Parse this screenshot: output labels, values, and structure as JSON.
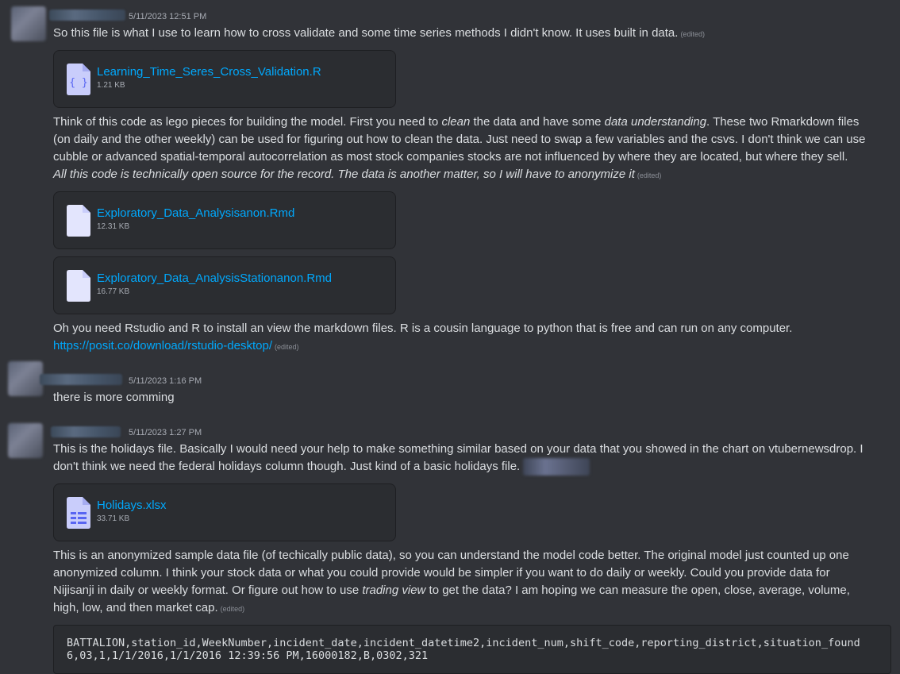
{
  "messages": [
    {
      "timestamp": "5/11/2023 12:51 PM",
      "text": "So this file is what I use to learn how to cross validate and some time series methods I didn't know.   It uses built in data.",
      "edited": "(edited)",
      "attachment": {
        "name": "Learning_Time_Seres_Cross_Validation.R",
        "size": "1.21 KB",
        "icon": "code-file-icon"
      },
      "p2": {
        "l1a": "Think of this code as lego pieces for building the model.  First you need to ",
        "l1b": "clean",
        "l1c": " the data and have some ",
        "l1d": "data understanding",
        "l1e": ".  These two Rmarkdown files",
        "l2": "(on daily and the other weekly) can be used for figuring out how to clean the data. Just need to swap a few variables and the csvs.  I don't think we can use",
        "l3": "cubble or advanced spatial-temporal autocorrelation as most stock companies stocks are not influenced by where they are located, but where they sell.",
        "l4": "All this code is technically open source for the record. The data is another matter, so I will have to anonymize it",
        "edited": "(edited)"
      },
      "attachments2": [
        {
          "name": "Exploratory_Data_Analysisanon.Rmd",
          "size": "12.31 KB",
          "icon": "document-file-icon"
        },
        {
          "name": "Exploratory_Data_AnalysisStationanon.Rmd",
          "size": "16.77 KB",
          "icon": "document-file-icon"
        }
      ],
      "p3": {
        "l1": "Oh you need Rstudio and R to install an view the markdown files.  R is a cousin language to python that is free and can run on any computer.",
        "link": "https://posit.co/download/rstudio-desktop/",
        "edited": "(edited)"
      }
    },
    {
      "timestamp": "5/11/2023 1:16 PM",
      "text": "there is more comming"
    },
    {
      "timestamp": "5/11/2023 1:27 PM",
      "l1": "This is the holidays file.  Basically I would need your help to make something similar based on your data that you showed in the chart on vtubernewsdrop.  I",
      "l2": "don't think we need the federal holidays column though.  Just kind of a basic holidays file.",
      "attachment": {
        "name": "Holidays.xlsx",
        "size": "33.71 KB",
        "icon": "spreadsheet-file-icon"
      },
      "p2": {
        "l1": "This is an anonymized sample data file (of techically public data), so you can understand the model code better.   The original model just counted up one",
        "l2": "anonymized column.  I think your stock data or what you could provide would be simpler if you want to do daily or weekly.   Could you provide data for",
        "l3a": "Nijisanji in daily or weekly format.  Or figure out how to use ",
        "l3b": "trading view",
        "l3c": " to get the data?  I am hoping we can measure the open, close, average, volume,",
        "l4": "high, low, and then market cap.",
        "edited": "(edited)"
      },
      "code": {
        "line1": "BATTALION,station_id,WeekNumber,incident_date,incident_datetime2,incident_num,shift_code,reporting_district,situation_found",
        "line2": "6,03,1,1/1/2016,1/1/2016 12:39:56 PM,16000182,B,0302,321"
      }
    }
  ],
  "colors": {
    "background": "#313338",
    "text": "#dbdee1",
    "link": "#00a8fc",
    "attachment_bg": "#2b2d31",
    "icon": "#c9cdfb"
  }
}
